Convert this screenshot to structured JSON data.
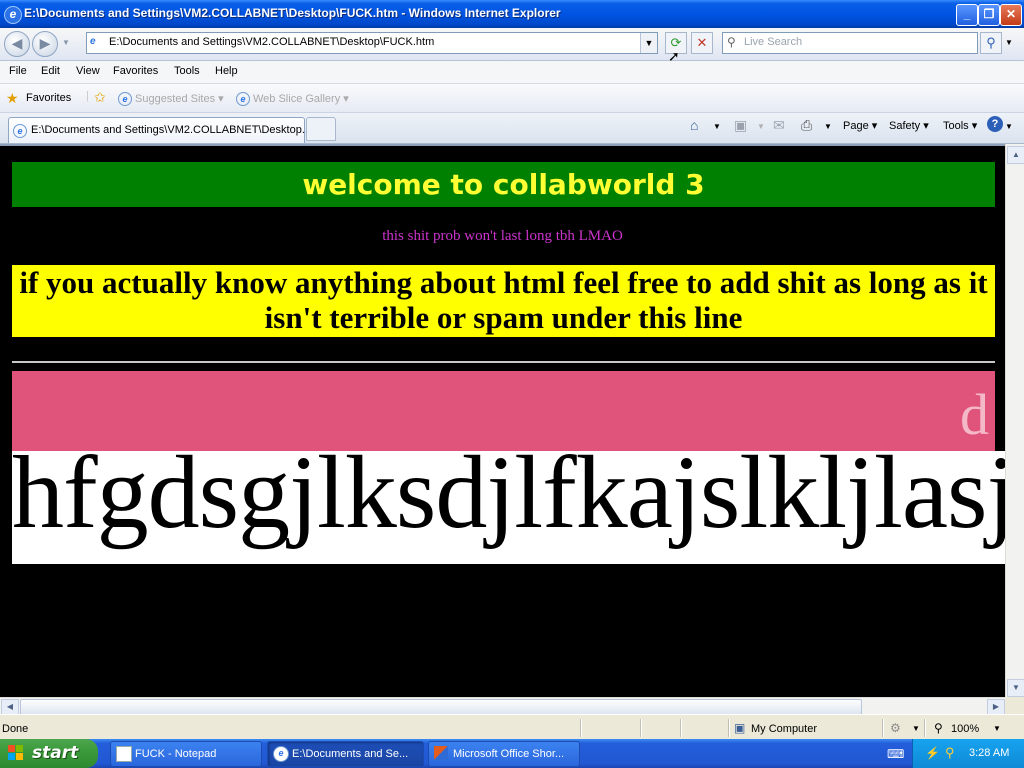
{
  "window": {
    "title": "E:\\Documents and Settings\\VM2.COLLABNET\\Desktop\\FUCK.htm - Windows Internet Explorer",
    "min_label": "_",
    "max_label": "❐",
    "close_label": "✕"
  },
  "navbar": {
    "address": "E:\\Documents and Settings\\VM2.COLLABNET\\Desktop\\FUCK.htm",
    "search_placeholder": "Live Search"
  },
  "menubar": {
    "items": [
      "File",
      "Edit",
      "View",
      "Favorites",
      "Tools",
      "Help"
    ]
  },
  "favbar": {
    "favorites_label": "Favorites",
    "suggested_sites": "Suggested Sites",
    "web_slice_gallery": "Web Slice Gallery"
  },
  "tabs": {
    "active_tab_label": "E:\\Documents and Settings\\VM2.COLLABNET\\Desktop...",
    "commands": {
      "page": "Page",
      "safety": "Safety",
      "tools": "Tools"
    }
  },
  "page": {
    "heading": "welcome to collabworld 3",
    "subline": "this shit prob won't last long tbh LMAO",
    "notice": "if you actually know anything about html feel free to add shit as long as it isn't terrible or spam under this line",
    "pink_text": "d",
    "big_text": "hfgdsgjlksdjlfkajslkljlasjdlkfjas"
  },
  "statusbar": {
    "status": "Done",
    "zone": "My Computer",
    "zoom": "100%"
  },
  "taskbar": {
    "start_label": "start",
    "tasks": [
      {
        "label": "FUCK - Notepad"
      },
      {
        "label": "E:\\Documents and Se..."
      },
      {
        "label": "Microsoft Office Shor..."
      }
    ],
    "clock": "3:28 AM"
  },
  "colors": {
    "heading_bg": "#008000",
    "heading_text": "#ffff33",
    "subline_text": "#cc33cc",
    "notice_bg": "#ffff00",
    "pink_bg": "#e0537a",
    "page_bg": "#000000"
  }
}
